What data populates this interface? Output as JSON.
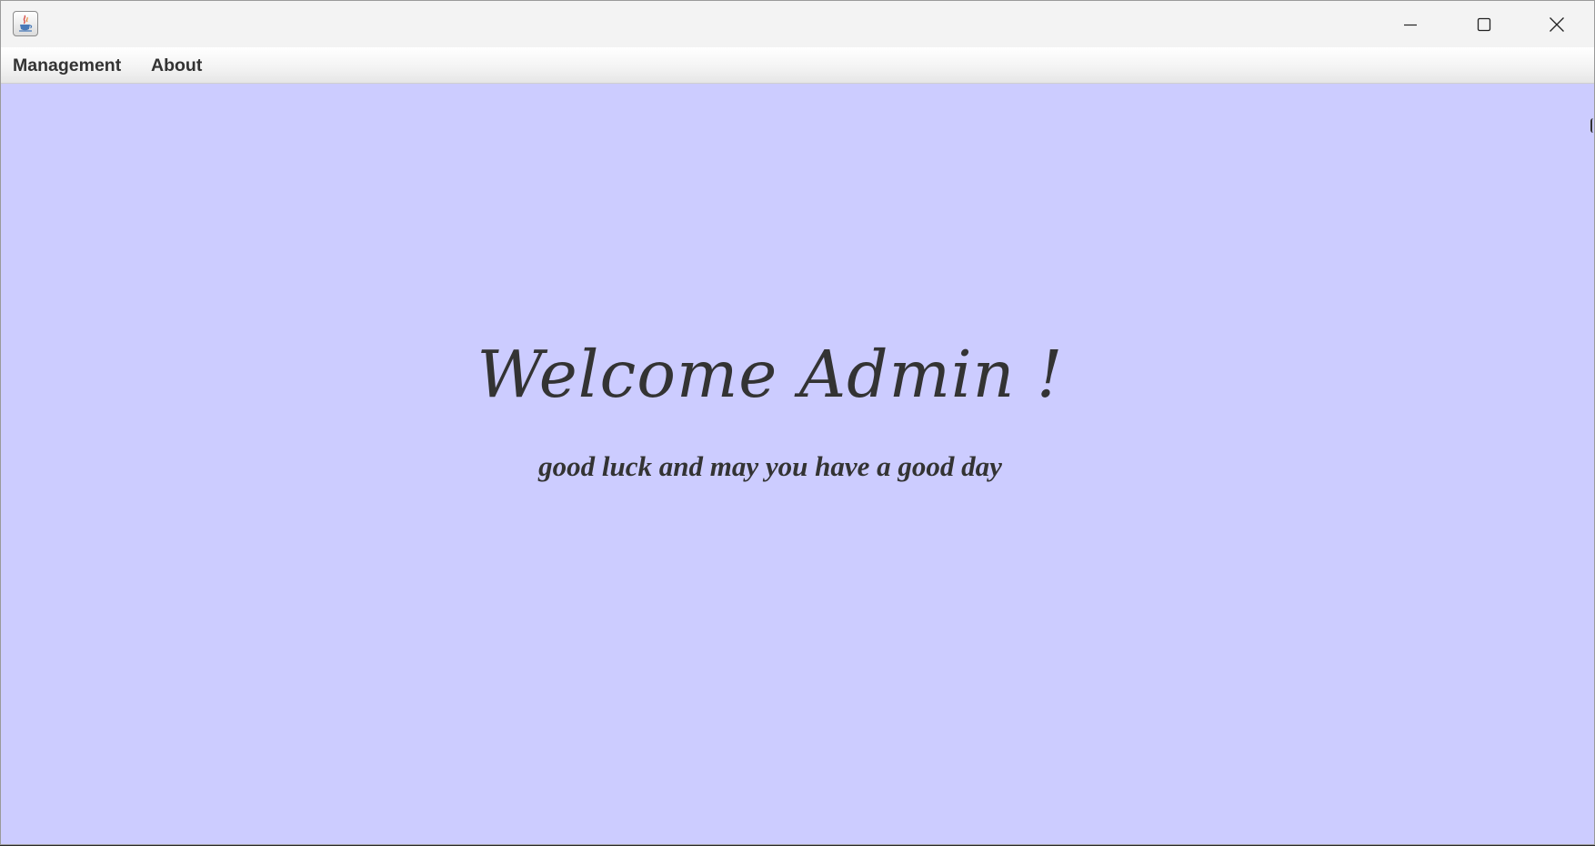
{
  "window": {
    "icon": "java-cup-icon",
    "controls": {
      "minimize_icon": "minimize-icon",
      "maximize_icon": "maximize-icon",
      "close_icon": "close-icon"
    }
  },
  "menubar": {
    "items": [
      {
        "label": "Management"
      },
      {
        "label": "About"
      }
    ]
  },
  "main": {
    "title": "Welcome Admin !",
    "subtitle": "good luck and may you have a good day",
    "background_color": "#ccccff",
    "text_color": "#333333"
  }
}
